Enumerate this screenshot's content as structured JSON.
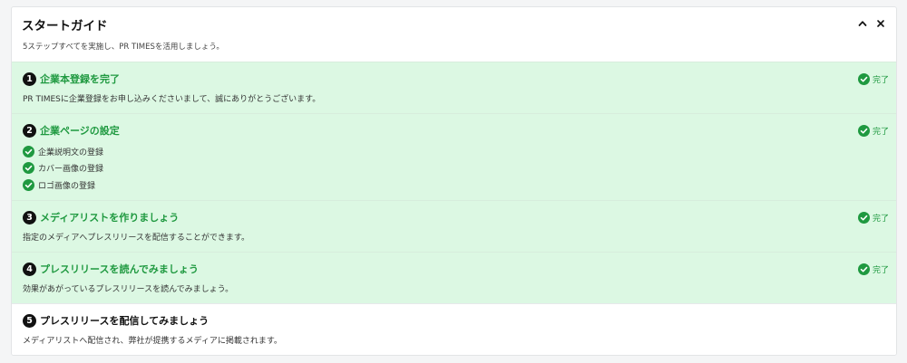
{
  "guide": {
    "title": "スタートガイド",
    "subtitle": "5ステップすべてを実施し、PR TIMESを活用しましょう。",
    "collapse_icon": "chevron-up-icon",
    "close_icon": "close-icon"
  },
  "colors": {
    "done_background": "#dcf8e3",
    "accent_green": "#1f9940",
    "number_badge": "#111111"
  },
  "steps": [
    {
      "number": "1",
      "title": "企業本登録を完了",
      "description": "PR TIMESに企業登録をお申し込みくださいまして、誠にありがとうございます。",
      "status": "完了",
      "completed": true
    },
    {
      "number": "2",
      "title": "企業ページの設定",
      "status": "完了",
      "completed": true,
      "subitems": [
        {
          "label": "企業説明文の登録",
          "done": true
        },
        {
          "label": "カバー画像の登録",
          "done": true
        },
        {
          "label": "ロゴ画像の登録",
          "done": true
        }
      ]
    },
    {
      "number": "3",
      "title": "メディアリストを作りましょう",
      "description": "指定のメディアへプレスリリースを配信することができます。",
      "status": "完了",
      "completed": true
    },
    {
      "number": "4",
      "title": "プレスリリースを読んでみましょう",
      "description": "効果があがっているプレスリリースを読んでみましょう。",
      "status": "完了",
      "completed": true
    },
    {
      "number": "5",
      "title": "プレスリリースを配信してみましょう",
      "description": "メディアリストへ配信され、弊社が提携するメディアに掲載されます。",
      "completed": false
    }
  ]
}
